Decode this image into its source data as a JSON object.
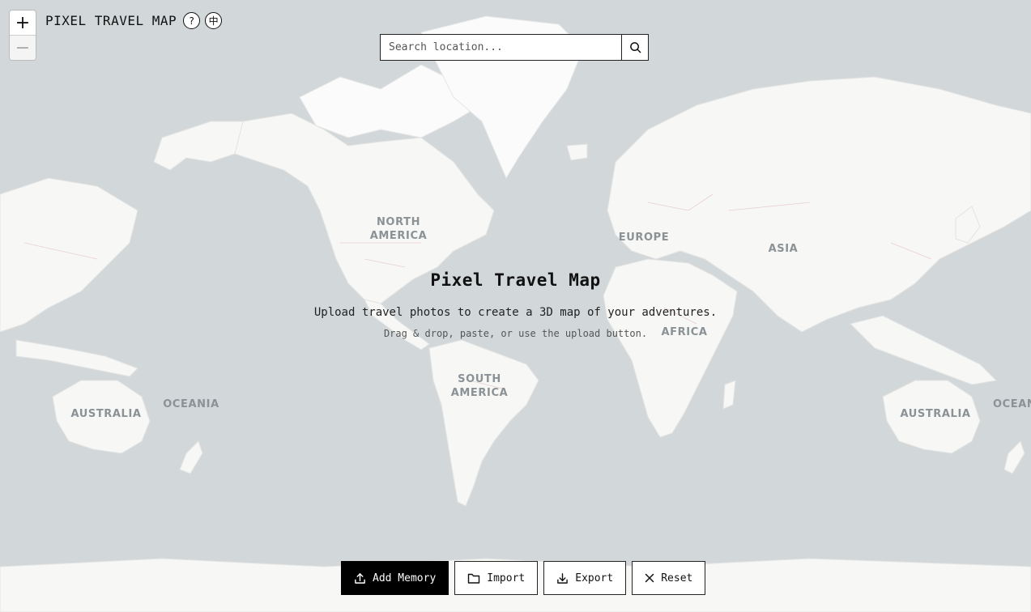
{
  "app": {
    "title": "PIXEL TRAVEL MAP",
    "help_glyph": "?",
    "language_glyph": "中"
  },
  "zoom": {
    "in_label": "+",
    "out_label": "−"
  },
  "search": {
    "placeholder": "Search location...",
    "value": ""
  },
  "map": {
    "continent_labels": {
      "north_america_1": "NORTH",
      "north_america_2": "AMERICA",
      "south_america_1": "SOUTH",
      "south_america_2": "AMERICA",
      "europe": "EUROPE",
      "asia": "ASIA",
      "africa": "AFRICA",
      "australia_west": "AUSTRALIA",
      "oceania_west": "OCEANIA",
      "australia_east": "AUSTRALIA",
      "oceania_east": "OCEAN"
    }
  },
  "empty_state": {
    "title": "Pixel Travel Map",
    "subtitle": "Upload travel photos to create a 3D map of your adventures.",
    "hint": "Drag & drop, paste, or use the upload button."
  },
  "toolbar": {
    "add_memory": "Add Memory",
    "import": "Import",
    "export": "Export",
    "reset": "Reset"
  },
  "icons": {
    "search": "search-icon",
    "upload": "upload-icon",
    "folder": "folder-icon",
    "download": "download-icon",
    "close": "close-icon",
    "help": "help-icon",
    "language": "language-icon"
  },
  "colors": {
    "ocean": "#d2d8da",
    "land": "#f7f7f6",
    "primary_button": "#000000"
  }
}
